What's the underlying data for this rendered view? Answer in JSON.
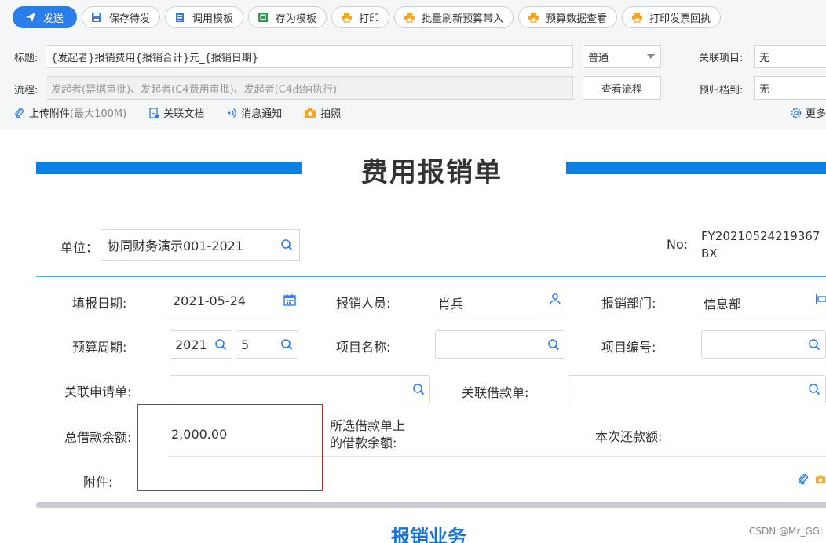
{
  "toolbar": {
    "send": "发送",
    "save_draft": "保存待发",
    "use_template": "调用模板",
    "save_template": "存为模板",
    "print": "打印",
    "batch_refresh": "批量刷新预算带入",
    "budget_view": "预算数据查看",
    "print_receipt": "打印发票回执"
  },
  "header": {
    "title_label": "标题:",
    "title_value": "{发起者}报销费用{报销合计}元_{报销日期}",
    "priority_value": "普通",
    "related_project_label": "关联项目:",
    "related_project_value": "无",
    "flow_label": "流程:",
    "flow_value": "发起者(票据审批)、发起者(C4费用审批)、发起者(C4出纳执行)",
    "view_flow": "查看流程",
    "archive_label": "预归档到:",
    "archive_value": "无",
    "upload_label": "上传附件",
    "upload_limit": "(最大100M)",
    "related_doc": "关联文档",
    "notify": "消息通知",
    "photo": "拍照",
    "more": "更多"
  },
  "form": {
    "title": "费用报销单",
    "unit_label": "单位：",
    "unit_value": "协同财务演示001-2021",
    "no_label": "No:",
    "no_value": "FY20210524219367BX",
    "fill_date_label": "填报日期:",
    "fill_date_value": "2021-05-24",
    "person_label": "报销人员:",
    "person_value": "肖兵",
    "dept_label": "报销部门:",
    "dept_value": "信息部",
    "budget_period_label": "预算周期:",
    "budget_year": "2021",
    "budget_month": "5",
    "project_name_label": "项目名称:",
    "project_no_label": "项目编号:",
    "related_request_label": "关联申请单:",
    "related_loan_label": "关联借款单:",
    "total_loan_label": "总借款余额:",
    "total_loan_value": "2,000.00",
    "selected_loan_label_1": "所选借款单上",
    "selected_loan_label_2": "的借款余额:",
    "repay_label": "本次还款额:",
    "attachment_label": "附件:",
    "section_title": "报销业务"
  },
  "watermark": "CSDN @Mr_GGI",
  "colors": {
    "accent": "#2b7de9",
    "bar": "#0a7fe5",
    "highlight": "#e02020",
    "printer": "#f5a623"
  }
}
